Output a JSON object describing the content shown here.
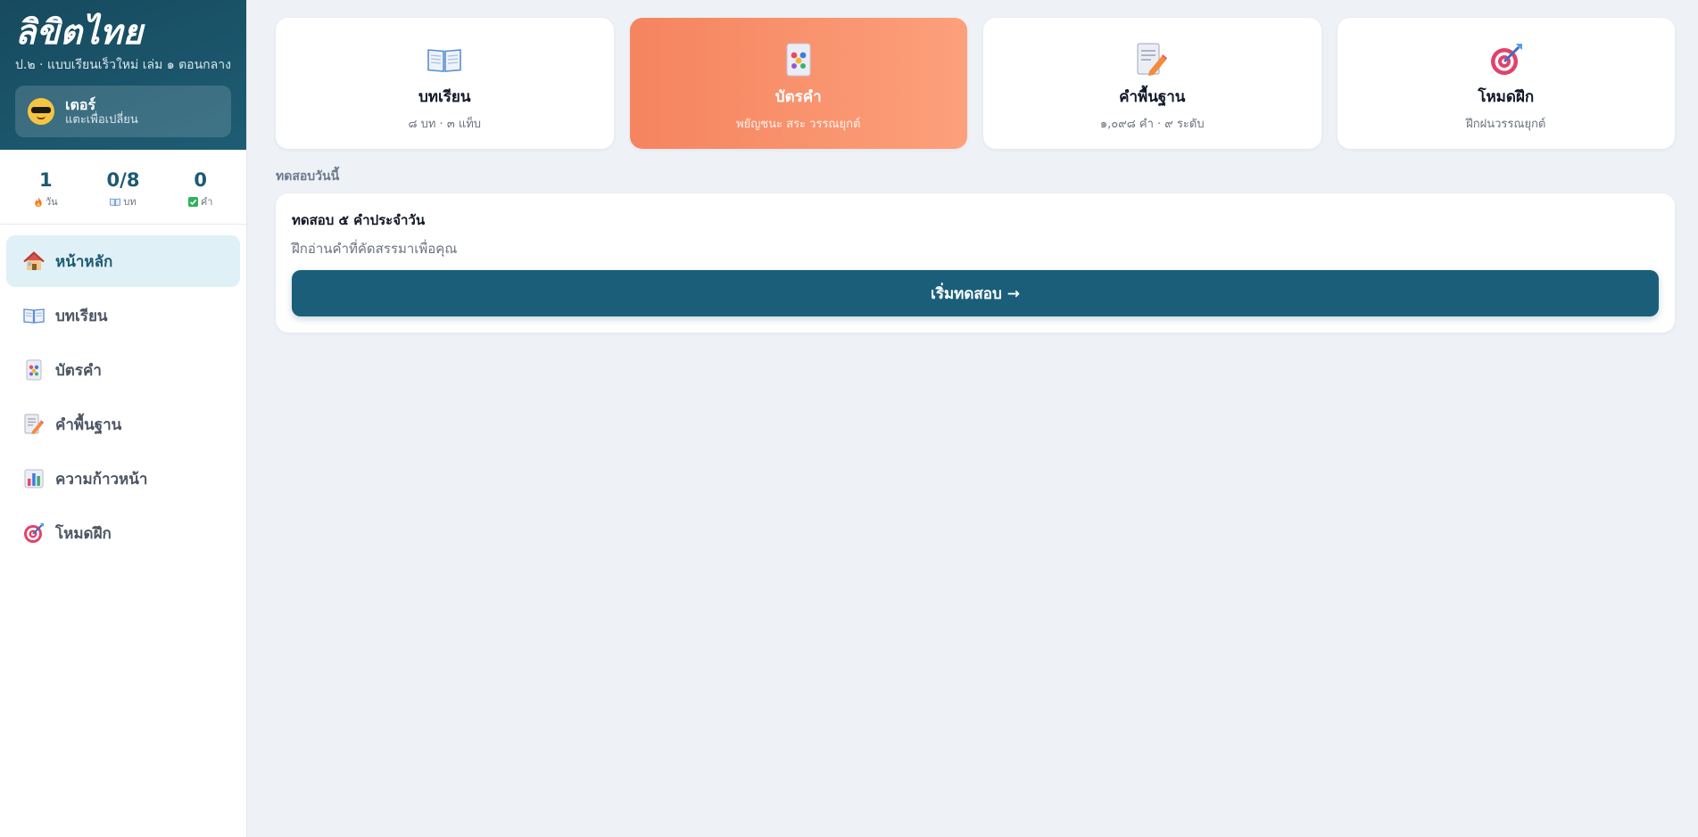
{
  "app": {
    "title": "ลิขิตไทย",
    "subtitle": "ป.๒ · แบบเรียนเร็วใหม่ เล่ม ๑ ตอนกลาง"
  },
  "profile": {
    "name": "เตอร์",
    "hint": "แตะเพื่อเปลี่ยน",
    "avatar_icon": "sunglasses-face-icon"
  },
  "stats": [
    {
      "value": "1",
      "label": "วัน",
      "icon": "fire-icon"
    },
    {
      "value": "0/8",
      "label": "บท",
      "icon": "book-icon"
    },
    {
      "value": "0",
      "label": "คำ",
      "icon": "check-icon"
    }
  ],
  "nav": {
    "items": [
      {
        "label": "หน้าหลัก",
        "icon": "house-icon",
        "active": true
      },
      {
        "label": "บทเรียน",
        "icon": "book-icon",
        "active": false
      },
      {
        "label": "บัตรคำ",
        "icon": "card-icon",
        "active": false
      },
      {
        "label": "คำพื้นฐาน",
        "icon": "memo-icon",
        "active": false
      },
      {
        "label": "ความก้าวหน้า",
        "icon": "bar-chart-icon",
        "active": false
      },
      {
        "label": "โหมดฝึก",
        "icon": "target-icon",
        "active": false
      }
    ]
  },
  "cards": [
    {
      "title": "บทเรียน",
      "sub": "๘ บท · ๓ แท็บ",
      "icon": "book-icon",
      "active": false
    },
    {
      "title": "บัตรคำ",
      "sub": "พยัญชนะ สระ วรรณยุกต์",
      "icon": "card-icon",
      "active": true
    },
    {
      "title": "คำพื้นฐาน",
      "sub": "๑,๐๙๘ คำ · ๙ ระดับ",
      "icon": "memo-icon",
      "active": false
    },
    {
      "title": "โหมดฝึก",
      "sub": "ฝึกฝนวรรณยุกต์",
      "icon": "target-icon",
      "active": false
    }
  ],
  "quiz": {
    "section_label": "ทดสอบวันนี้",
    "title": "ทดสอบ ๕ คำประจำวัน",
    "description": "ฝึกอ่านคำที่คัดสรรมาเพื่อคุณ",
    "button_label": "เริ่มทดสอบ →"
  },
  "colors": {
    "brand": "#1b5e7a",
    "accent": "#f5845f",
    "active_nav_bg": "#dff1f7",
    "background": "#eef1f6"
  }
}
